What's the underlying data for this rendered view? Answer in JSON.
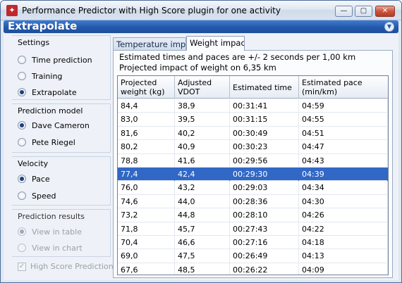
{
  "window": {
    "title": "Performance Predictor with High Score plugin for one activity",
    "buttons": {
      "minimize": "—",
      "maximize": "▢",
      "close": "✕"
    }
  },
  "header": {
    "title": "Extrapolate",
    "collapse_icon": "chevron-down-icon"
  },
  "settings": {
    "title": "Settings",
    "options": [
      {
        "label": "Time prediction",
        "checked": false
      },
      {
        "label": "Training",
        "checked": false
      },
      {
        "label": "Extrapolate",
        "checked": true
      }
    ]
  },
  "prediction_model": {
    "title": "Prediction model",
    "options": [
      {
        "label": "Dave Cameron",
        "checked": true
      },
      {
        "label": "Pete Riegel",
        "checked": false
      }
    ]
  },
  "velocity": {
    "title": "Velocity",
    "options": [
      {
        "label": "Pace",
        "checked": true
      },
      {
        "label": "Speed",
        "checked": false
      }
    ]
  },
  "prediction_results": {
    "title": "Prediction results",
    "options": [
      {
        "label": "View in table",
        "checked": true,
        "disabled": true
      },
      {
        "label": "View in chart",
        "checked": false,
        "disabled": true
      }
    ]
  },
  "high_score": {
    "label": "High Score Prediction",
    "checked": true,
    "disabled": true
  },
  "tabs": [
    {
      "label": "Temperature impac",
      "active": false
    },
    {
      "label": "Weight impact",
      "active": true
    }
  ],
  "info": {
    "line1": "Estimated times and paces are +/- 2 seconds per 1,00 km",
    "line2": "Projected impact of weight on 6,35 km"
  },
  "table": {
    "columns": [
      "Projected\nweight (kg)",
      "Adjusted\nVDOT",
      "Estimated time",
      "Estimated pace\n(min/km)"
    ],
    "rows": [
      [
        "84,4",
        "38,9",
        "00:31:41",
        "04:59"
      ],
      [
        "83,0",
        "39,5",
        "00:31:15",
        "04:55"
      ],
      [
        "81,6",
        "40,2",
        "00:30:49",
        "04:51"
      ],
      [
        "80,2",
        "40,9",
        "00:30:23",
        "04:47"
      ],
      [
        "78,8",
        "41,6",
        "00:29:56",
        "04:43"
      ],
      [
        "77,4",
        "42,4",
        "00:29:30",
        "04:39"
      ],
      [
        "76,0",
        "43,2",
        "00:29:03",
        "04:34"
      ],
      [
        "74,6",
        "44,0",
        "00:28:36",
        "04:30"
      ],
      [
        "73,2",
        "44,8",
        "00:28:10",
        "04:26"
      ],
      [
        "71,8",
        "45,7",
        "00:27:43",
        "04:22"
      ],
      [
        "70,4",
        "46,6",
        "00:27:16",
        "04:18"
      ],
      [
        "69,0",
        "47,5",
        "00:26:49",
        "04:13"
      ],
      [
        "67,6",
        "48,5",
        "00:26:22",
        "04:09"
      ]
    ],
    "selected_row": 5
  },
  "colors": {
    "header_bar": "#2359ab",
    "selection": "#3168c6"
  }
}
